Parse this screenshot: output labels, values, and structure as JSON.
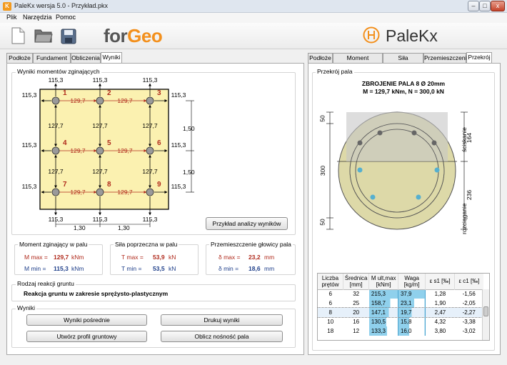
{
  "window": {
    "title": "PaleKx wersja 5.0 - Przykład.pkx",
    "minimize": "–",
    "maximize": "□",
    "close": "x"
  },
  "menu": [
    "Plik",
    "Narzędzia",
    "Pomoc"
  ],
  "brand": {
    "forgeo_a": "for",
    "forgeo_b": "Geo",
    "palekx": "PaleKx"
  },
  "left_tabs": [
    "Podłoże",
    "Fundament",
    "Obliczenia",
    "Wyniki"
  ],
  "right_tabs": [
    "Podłoże",
    "Moment zginający",
    "Siła poprzeczna",
    "Przemieszczenie",
    "Przekrój"
  ],
  "moments_group": "Wyniki momentów zginających",
  "grid": {
    "top_labels": [
      "115,3",
      "115,3",
      "115,3"
    ],
    "bottom_labels": [
      "115,3",
      "115,3",
      "115,3"
    ],
    "left_labels": [
      "115,3",
      "115,3",
      "115,3"
    ],
    "right_labels": [
      "115,3",
      "115,3",
      "115,3"
    ],
    "h_labels": [
      "129,7",
      "129,7",
      "129,7",
      "129,7",
      "129,7",
      "129,7"
    ],
    "v_labels": [
      "127,7",
      "127,7",
      "127,7",
      "127,7",
      "127,7",
      "127,7"
    ],
    "pile_numbers": [
      "1",
      "2",
      "3",
      "4",
      "5",
      "6",
      "7",
      "8",
      "9"
    ],
    "dim_right": [
      "1,50",
      "1,50"
    ],
    "dim_bottom": [
      "1,30",
      "1,30"
    ]
  },
  "analysis_button": "Przykład analizy wyników",
  "moment": {
    "title": "Moment zginający w palu",
    "max_label": "M max =",
    "max_value": "129,7",
    "min_label": "M min =",
    "min_value": "115,3",
    "unit": "kNm"
  },
  "shear": {
    "title": "Siła poprzeczna w palu",
    "max_label": "T max =",
    "max_value": "53,9",
    "min_label": "T min =",
    "min_value": "53,5",
    "unit": "kN"
  },
  "displacement": {
    "title": "Przemieszczenie głowicy pala",
    "max_label": "δ max =",
    "max_value": "23,2",
    "min_label": "δ min =",
    "min_value": "18,6",
    "unit": "mm"
  },
  "reaction": {
    "title": "Rodzaj reakcji gruntu",
    "value": "Reakcja gruntu w zakresie sprężysto-plastycznym"
  },
  "results": {
    "title": "Wyniki",
    "btn1": "Wyniki pośrednie",
    "btn2": "Drukuj wyniki",
    "btn3": "Utwórz profil gruntowy",
    "btn4": "Oblicz nośność pala"
  },
  "section": {
    "group_title": "Przekrój pala",
    "heading1": "ZBROJENIE PALA 8 Ø 20mm",
    "heading2": "M = 129,7 kNm,  N = 300,0 kN",
    "dim_left": [
      "50",
      "300",
      "50"
    ],
    "dim_right": [
      "164",
      "236"
    ],
    "compress": "ściskanie",
    "tension": "rozciąganie"
  },
  "rebar_table": {
    "headers": [
      "Liczba prętów",
      "Średnica [mm]",
      "M ult,max [kNm]",
      "Waga [kg/m]",
      "ε s1 [‰]",
      "ε c1 [‰]"
    ],
    "rows": [
      [
        "6",
        "32",
        "215,3",
        "37,9",
        "1,28",
        "-1,56"
      ],
      [
        "6",
        "25",
        "158,7",
        "23,1",
        "1,90",
        "-2,05"
      ],
      [
        "8",
        "20",
        "147,1",
        "19,7",
        "2,47",
        "-2,27"
      ],
      [
        "10",
        "16",
        "130,5",
        "15,8",
        "4,32",
        "-3,38"
      ],
      [
        "18",
        "12",
        "133,3",
        "16,0",
        "3,80",
        "-3,02"
      ]
    ]
  }
}
